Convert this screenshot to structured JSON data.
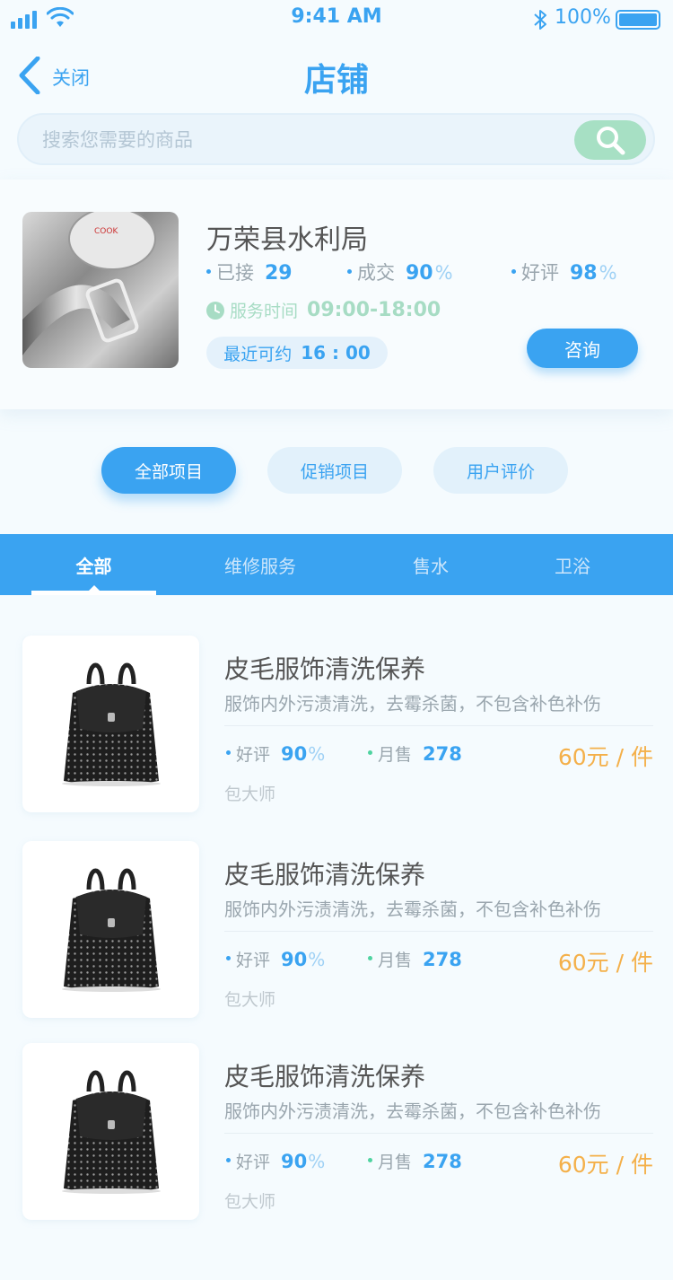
{
  "status_bar": {
    "time": "9:41 AM",
    "battery": "100%"
  },
  "nav": {
    "back_label": "关闭",
    "title": "店铺"
  },
  "search": {
    "placeholder": "搜索您需要的商品"
  },
  "shop": {
    "name": "万荣县水利局",
    "stats": [
      {
        "label": "已接",
        "value": "29",
        "suffix": ""
      },
      {
        "label": "成交",
        "value": "90",
        "suffix": "%"
      },
      {
        "label": "好评",
        "value": "98",
        "suffix": "%"
      }
    ],
    "service_label": "服务时间",
    "service_hours": "09:00-18:00",
    "recent_label": "最近可约",
    "recent_time": "16 : 00",
    "consult_label": "咨询"
  },
  "pill_tabs": [
    {
      "label": "全部项目",
      "active": true
    },
    {
      "label": "促销项目",
      "active": false
    },
    {
      "label": "用户评价",
      "active": false
    }
  ],
  "categories": [
    {
      "label": "全部",
      "active": true
    },
    {
      "label": "维修服务",
      "active": false
    },
    {
      "label": "售水",
      "active": false
    },
    {
      "label": "卫浴",
      "active": false
    }
  ],
  "products": [
    {
      "title": "皮毛服饰清洗保养",
      "desc": "服饰内外污渍清洗，去霉杀菌，不包含补色补伤",
      "rating_label": "好评",
      "rating": "90",
      "rating_suffix": "%",
      "sales_label": "月售",
      "sales": "278",
      "price": "60元 / 件",
      "vendor": "包大师"
    },
    {
      "title": "皮毛服饰清洗保养",
      "desc": "服饰内外污渍清洗，去霉杀菌，不包含补色补伤",
      "rating_label": "好评",
      "rating": "90",
      "rating_suffix": "%",
      "sales_label": "月售",
      "sales": "278",
      "price": "60元 / 件",
      "vendor": "包大师"
    },
    {
      "title": "皮毛服饰清洗保养",
      "desc": "服饰内外污渍清洗，去霉杀菌，不包含补色补伤",
      "rating_label": "好评",
      "rating": "90",
      "rating_suffix": "%",
      "sales_label": "月售",
      "sales": "278",
      "price": "60元 / 件",
      "vendor": "包大师"
    }
  ],
  "colors": {
    "primary": "#3aa3f1",
    "service_green": "#a7dcc4",
    "price_orange": "#f4b04a",
    "sales_dot": "#4fd3a0"
  }
}
